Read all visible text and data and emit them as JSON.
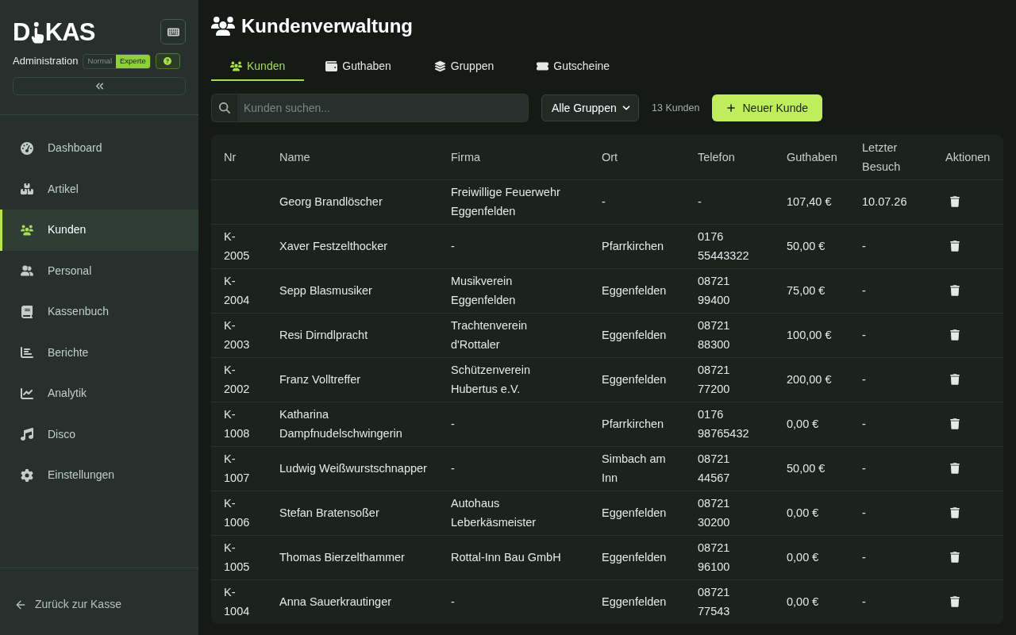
{
  "sidebar": {
    "logo": {
      "parts": [
        "D",
        "KAS"
      ]
    },
    "subtitle": "Administration",
    "mode_toggle": [
      {
        "label": "Normal",
        "selected": false
      },
      {
        "label": "Experte",
        "selected": true
      }
    ],
    "nav": [
      {
        "label": "Dashboard",
        "selected": false
      },
      {
        "label": "Artikel",
        "selected": false
      },
      {
        "label": "Kunden",
        "selected": true
      },
      {
        "label": "Personal",
        "selected": false
      },
      {
        "label": "Kassenbuch",
        "selected": false
      },
      {
        "label": "Berichte",
        "selected": false
      },
      {
        "label": "Analytik",
        "selected": false
      },
      {
        "label": "Disco",
        "selected": false
      },
      {
        "label": "Einstellungen",
        "selected": false
      }
    ],
    "footer_link": "Zurück zur Kasse"
  },
  "header": {
    "title": "Kundenverwaltung"
  },
  "tabs": [
    {
      "label": "Kunden",
      "selected": true
    },
    {
      "label": "Guthaben",
      "selected": false
    },
    {
      "label": "Gruppen",
      "selected": false
    },
    {
      "label": "Gutscheine",
      "selected": false
    }
  ],
  "toolbar": {
    "search": {
      "placeholder": "Kunden suchen..."
    },
    "group_filter": "Alle Gruppen",
    "count": "13 Kunden",
    "new_button": "Neuer Kunde"
  },
  "table": {
    "columns": [
      "Nr",
      "Name",
      "Firma",
      "Ort",
      "Telefon",
      "Guthaben",
      "Letzter Besuch",
      "Aktionen"
    ],
    "rows": [
      {
        "name": "Georg Brandlöscher",
        "firma": "Freiwillige Feuerwehr Eggenfelden",
        "ort": "-",
        "telefon": "-",
        "guthaben": "107,40 €",
        "letzter_besuch": "10.07.26"
      },
      {
        "nr": "K-2005",
        "name": "Xaver Festzelthocker",
        "firma": "-",
        "ort": "Pfarrkirchen",
        "telefon": "0176 55443322",
        "guthaben": "50,00 €",
        "letzter_besuch": "-"
      },
      {
        "nr": "K-2004",
        "name": "Sepp Blasmusiker",
        "firma": "Musikverein Eggenfelden",
        "ort": "Eggenfelden",
        "telefon": "08721 99400",
        "guthaben": "75,00 €",
        "letzter_besuch": "-"
      },
      {
        "nr": "K-2003",
        "name": "Resi Dirndlpracht",
        "firma": "Trachtenverein d'Rottaler",
        "ort": "Eggenfelden",
        "telefon": "08721 88300",
        "guthaben": "100,00 €",
        "letzter_besuch": "-"
      },
      {
        "nr": "K-2002",
        "name": "Franz Volltreffer",
        "firma": "Schützenverein Hubertus e.V.",
        "ort": "Eggenfelden",
        "telefon": "08721 77200",
        "guthaben": "200,00 €",
        "letzter_besuch": "-"
      },
      {
        "nr": "K-1008",
        "name": "Katharina Dampfnudelschwingerin",
        "firma": "-",
        "ort": "Pfarrkirchen",
        "telefon": "0176 98765432",
        "guthaben": "0,00 €",
        "letzter_besuch": "-"
      },
      {
        "nr": "K-1007",
        "name": "Ludwig Weißwurstschnapper",
        "firma": "-",
        "ort": "Simbach am Inn",
        "telefon": "08721 44567",
        "guthaben": "50,00 €",
        "letzter_besuch": "-"
      },
      {
        "nr": "K-1006",
        "name": "Stefan Bratensoßer",
        "firma": "Autohaus Leberkäsmeister",
        "ort": "Eggenfelden",
        "telefon": "08721 30200",
        "guthaben": "0,00 €",
        "letzter_besuch": "-"
      },
      {
        "nr": "K-1005",
        "name": "Thomas Bierzelthammer",
        "firma": "Rottal-Inn Bau GmbH",
        "ort": "Eggenfelden",
        "telefon": "08721 96100",
        "guthaben": "0,00 €",
        "letzter_besuch": "-"
      },
      {
        "nr": "K-1004",
        "name": "Anna Sauerkrautinger",
        "firma": "-",
        "ort": "Eggenfelden",
        "telefon": "08721 77543",
        "guthaben": "0,00 €",
        "letzter_besuch": "-"
      }
    ]
  }
}
